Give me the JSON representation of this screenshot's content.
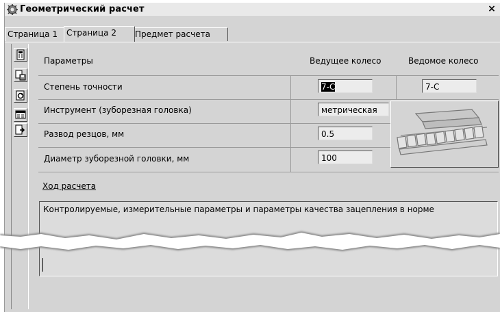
{
  "window": {
    "title": "Геометрический расчет",
    "close_label": "×"
  },
  "tabs": [
    {
      "label": "Страница 1"
    },
    {
      "label": "Страница 2"
    },
    {
      "label": "Предмет расчета"
    }
  ],
  "toolbar": [
    "calculator-icon",
    "save-icon",
    "refresh-icon",
    "report-icon",
    "export-icon"
  ],
  "grid": {
    "headers": {
      "params": "Параметры",
      "driving": "Ведущее колесо",
      "driven": "Ведомое колесо"
    },
    "rows": [
      {
        "label": "Степень точности",
        "driving": "7-С",
        "driven": "7-С"
      },
      {
        "label": "Инструмент (зуборезная головка)",
        "driving": "метрическая"
      },
      {
        "label": "Развод резцов, мм",
        "driving": "0.5"
      },
      {
        "label": "Диаметр зуборезной головки, мм",
        "driving": "100"
      }
    ]
  },
  "calc_link": "Ход расчета",
  "log_text": "Контролируемые, измерительные параметры и параметры качества зацепления в норме"
}
